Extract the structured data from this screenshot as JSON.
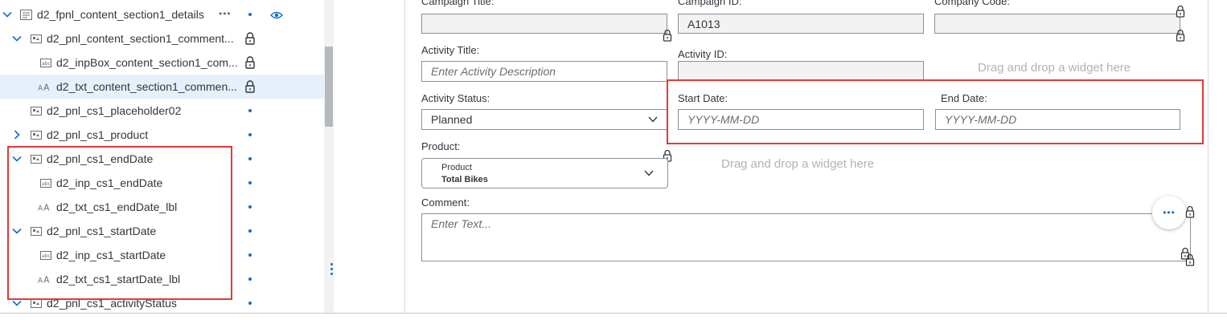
{
  "tree": {
    "items": [
      {
        "label": "d2_fpnl_content_section1_details",
        "more": "•••"
      },
      {
        "label": "d2_pnl_content_section1_comment..."
      },
      {
        "label": "d2_inpBox_content_section1_com..."
      },
      {
        "label": "d2_txt_content_section1_commen..."
      },
      {
        "label": "d2_pnl_cs1_placeholder02"
      },
      {
        "label": "d2_pnl_cs1_product"
      },
      {
        "label": "d2_pnl_cs1_endDate"
      },
      {
        "label": "d2_inp_cs1_endDate"
      },
      {
        "label": "d2_txt_cs1_endDate_lbl"
      },
      {
        "label": "d2_pnl_cs1_startDate"
      },
      {
        "label": "d2_inp_cs1_startDate"
      },
      {
        "label": "d2_txt_cs1_startDate_lbl"
      },
      {
        "label": "d2_pnl_cs1_activityStatus"
      }
    ]
  },
  "form": {
    "campaign_title_label": "Campaign Title:",
    "campaign_id_label": "Campaign ID:",
    "campaign_id_value": "A1013",
    "company_code_label": "Company Code:",
    "activity_title_label": "Activity Title:",
    "activity_title_placeholder": "Enter Activity Description",
    "activity_id_label": "Activity ID:",
    "activity_status_label": "Activity Status:",
    "activity_status_value": "Planned",
    "start_date_label": "Start Date:",
    "start_date_placeholder": "YYYY-MM-DD",
    "end_date_label": "End Date:",
    "end_date_placeholder": "YYYY-MM-DD",
    "product_label": "Product:",
    "product_small": "Product",
    "product_value": "Total Bikes",
    "comment_label": "Comment:",
    "comment_placeholder": "Enter Text...",
    "dropzone_1": "Drag and drop a widget here",
    "dropzone_2": "Drag and drop a widget here",
    "more_button": "•••"
  },
  "colors": {
    "highlight": "#e53935",
    "accent": "#0a6ed1",
    "selected_row": "#e5f0fa"
  }
}
